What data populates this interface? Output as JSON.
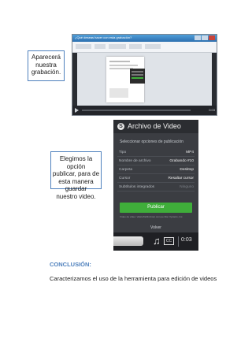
{
  "callout_recording": {
    "lines": [
      "Aparecerá",
      "nuestra",
      "grabación."
    ]
  },
  "callout_publish": {
    "lines": [
      "Elegimos la opción",
      "publicar, para de",
      "esta manera guardar",
      "nuestro video."
    ]
  },
  "screenshot_editor": {
    "title": "¿Qué deseas hacer con esta grabación?",
    "time": "0:03"
  },
  "video_panel": {
    "logo": "S",
    "title": "Archivo de Video",
    "subtitle": "Seleccionar opciones de publicación",
    "rows": [
      {
        "key": "Tipo",
        "value": "MP4"
      },
      {
        "key": "Nombre de archivo",
        "value": "Grabando #10"
      },
      {
        "key": "Carpeta",
        "value": "Desktop"
      },
      {
        "key": "Cursor",
        "value": "Resaltar cursor"
      },
      {
        "key": "Subtítulos integrados",
        "value": "Ninguno"
      }
    ],
    "publish_label": "Publicar",
    "note": "Vídeo de video: VaticeTaFilmCorp.com.pe Ron Vysterio, Inc.",
    "back_label": "Volver",
    "cc_label": "CC",
    "time": "0:03"
  },
  "conclusion": {
    "heading": "CONCLUSIÓN:",
    "text": "Caracterizamos el uso de la herramienta para edición de videos"
  }
}
